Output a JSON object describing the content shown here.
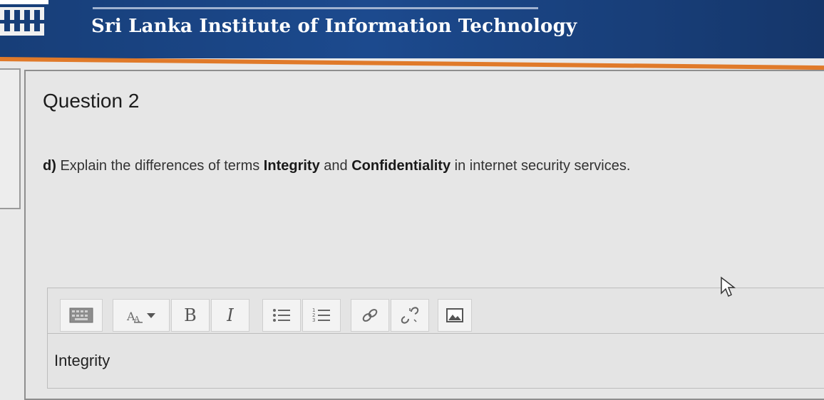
{
  "header": {
    "institute_name": "Sri Lanka Institute of Information Technology",
    "colors": {
      "bar": "#1c4a8e",
      "accent": "#e07a2a"
    }
  },
  "question": {
    "title": "Question 2",
    "label": "d)",
    "text_before": "Explain the differences of terms",
    "term1": "Integrity",
    "text_mid": "and",
    "term2": "Confidentiality",
    "text_after": "in internet security services."
  },
  "editor": {
    "toolbar": [
      {
        "name": "toggle-toolbar-button",
        "icon": "keyboard-icon"
      },
      {
        "name": "font-size-button",
        "icon": "font-size-icon"
      },
      {
        "name": "bold-button",
        "label": "B",
        "icon": "bold-icon"
      },
      {
        "name": "italic-button",
        "label": "I",
        "icon": "italic-icon"
      },
      {
        "name": "bullet-list-button",
        "icon": "bullet-list-icon"
      },
      {
        "name": "numbered-list-button",
        "icon": "numbered-list-icon"
      },
      {
        "name": "link-button",
        "icon": "link-icon"
      },
      {
        "name": "unlink-button",
        "icon": "unlink-icon"
      },
      {
        "name": "image-button",
        "icon": "image-icon"
      }
    ],
    "content": "Integrity"
  }
}
